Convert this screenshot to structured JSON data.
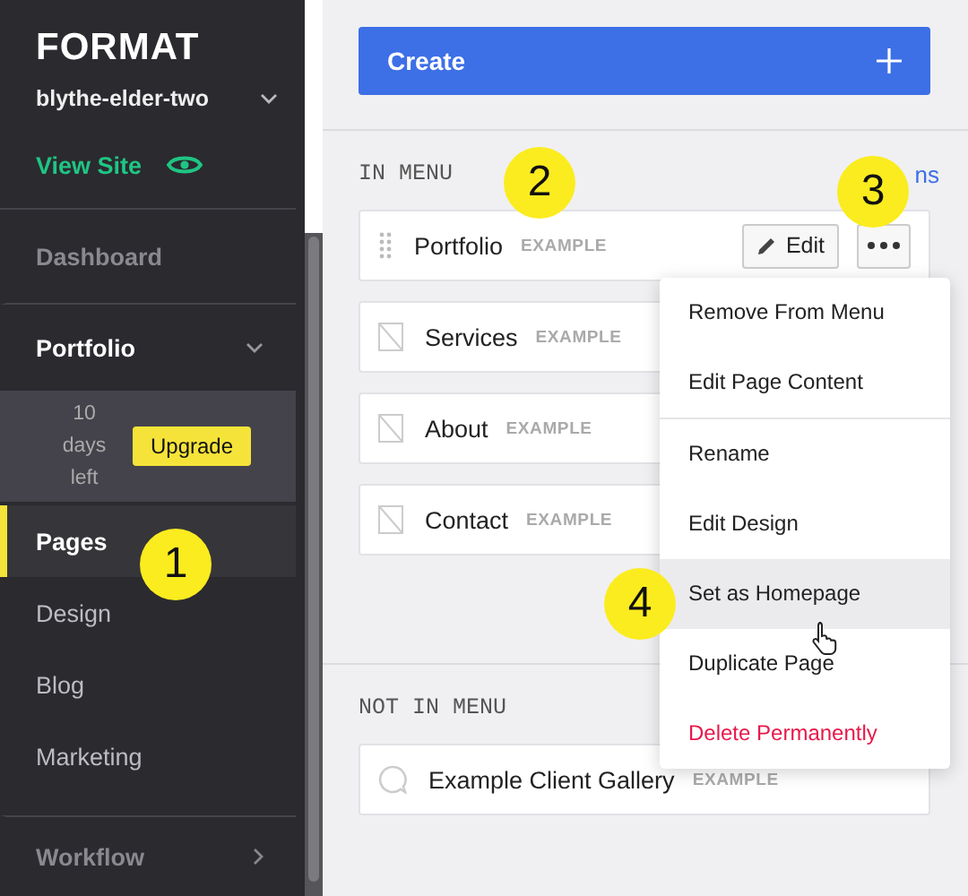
{
  "sidebar": {
    "logo": "FORMAT",
    "site": "blythe-elder-two",
    "view_site": "View Site",
    "items": [
      {
        "label": "Dashboard",
        "kind": "section",
        "selected": false
      },
      {
        "label": "Portfolio",
        "kind": "group",
        "selected": false,
        "expanded": true
      },
      {
        "kind": "trial",
        "text": "10 days left",
        "button": "Upgrade"
      },
      {
        "label": "Pages",
        "kind": "sub",
        "selected": true
      },
      {
        "label": "Design",
        "kind": "sub",
        "selected": false
      },
      {
        "label": "Blog",
        "kind": "sub",
        "selected": false
      },
      {
        "label": "Marketing",
        "kind": "sub",
        "selected": false
      },
      {
        "label": "Workflow",
        "kind": "group",
        "selected": false,
        "expanded": false
      }
    ]
  },
  "create_button": "Create",
  "sections": [
    {
      "title": "IN MENU",
      "action": "ns",
      "pages": [
        {
          "name": "Portfolio",
          "tag": "EXAMPLE",
          "hovered": true,
          "edit_button": "Edit"
        },
        {
          "name": "Services",
          "tag": "EXAMPLE",
          "kind": "page",
          "hovered": false
        },
        {
          "name": "About",
          "tag": "EXAMPLE",
          "kind": "page",
          "hovered": false
        },
        {
          "name": "Contact",
          "tag": "EXAMPLE",
          "kind": "page",
          "hovered": false
        }
      ]
    },
    {
      "title": "NOT IN MENU",
      "pages": [
        {
          "name": "Example Client Gallery",
          "tag": "EXAMPLE",
          "kind": "gallery",
          "hovered": false
        }
      ]
    }
  ],
  "menu": {
    "items": [
      {
        "label": "Remove From Menu",
        "kind": "normal",
        "hovered": false,
        "separator_before": false
      },
      {
        "label": "Edit Page Content",
        "kind": "normal",
        "hovered": false,
        "separator_before": false
      },
      {
        "label": "Rename",
        "kind": "normal",
        "hovered": false,
        "separator_before": true
      },
      {
        "label": "Edit Design",
        "kind": "normal",
        "hovered": false,
        "separator_before": false
      },
      {
        "label": "Set as Homepage",
        "kind": "normal",
        "hovered": true,
        "separator_before": false
      },
      {
        "label": "Duplicate Page",
        "kind": "normal",
        "hovered": false,
        "separator_before": false
      },
      {
        "label": "Delete Permanently",
        "kind": "danger",
        "hovered": false,
        "separator_before": false
      }
    ]
  },
  "callouts": [
    {
      "label": "1"
    },
    {
      "label": "2"
    },
    {
      "label": "3"
    },
    {
      "label": "4"
    }
  ]
}
